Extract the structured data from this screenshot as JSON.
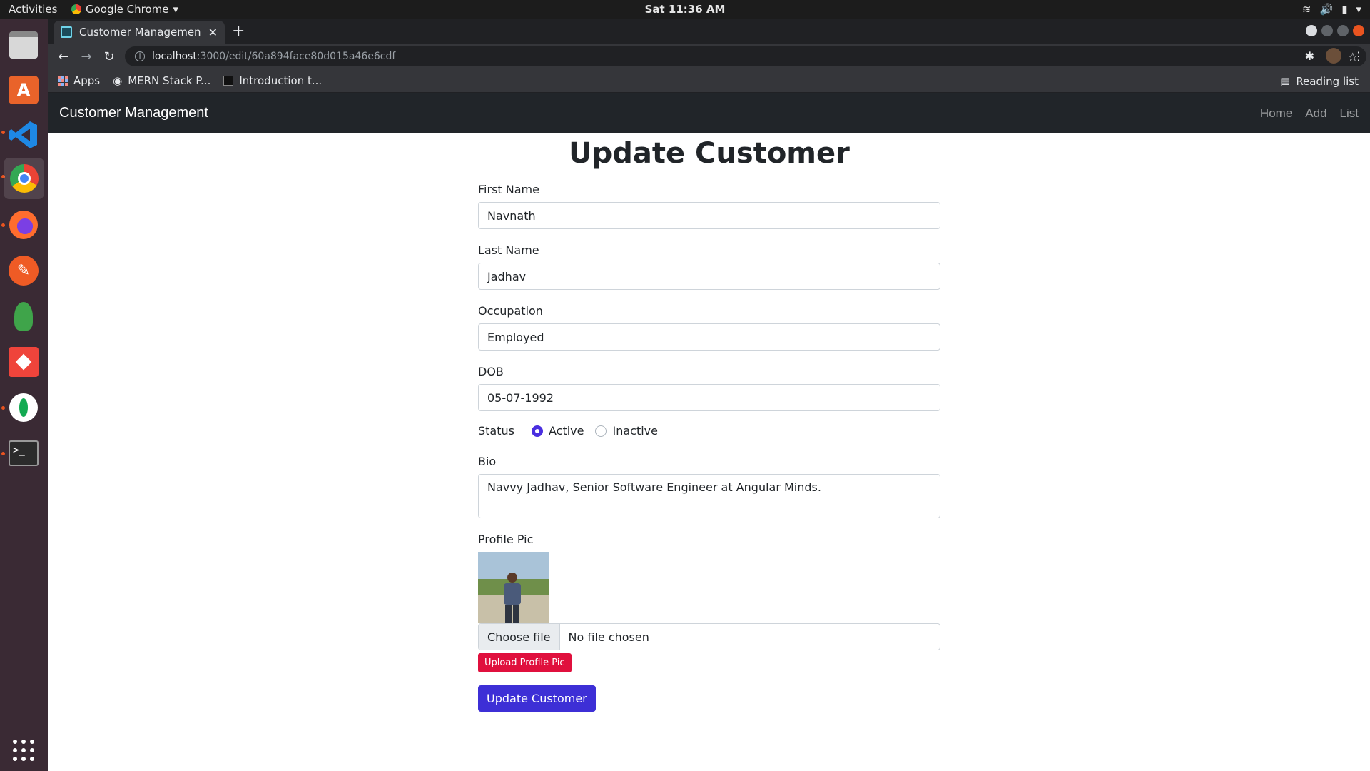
{
  "os": {
    "activities": "Activities",
    "app_menu": "Google Chrome",
    "clock": "Sat 11:36 AM"
  },
  "browser": {
    "tab_title": "Customer Management",
    "url_host": "localhost",
    "url_path": ":3000/edit/60a894face80d015a46e6cdf",
    "bookmarks": [
      "Apps",
      "MERN Stack P...",
      "Introduction t..."
    ],
    "reading_list": "Reading list"
  },
  "navbar": {
    "brand": "Customer Management",
    "links": [
      "Home",
      "Add",
      "List"
    ]
  },
  "form": {
    "title": "Update Customer",
    "first_name_label": "First Name",
    "first_name_value": "Navnath",
    "last_name_label": "Last Name",
    "last_name_value": "Jadhav",
    "occupation_label": "Occupation",
    "occupation_value": "Employed",
    "dob_label": "DOB",
    "dob_value": "05-07-1992",
    "status_label": "Status",
    "status_options": [
      "Active",
      "Inactive"
    ],
    "status_selected": "Active",
    "bio_label": "Bio",
    "bio_value": "Navvy Jadhav, Senior Software Engineer at Angular Minds.",
    "profile_pic_label": "Profile Pic",
    "choose_file": "Choose file",
    "no_file": "No file chosen",
    "upload_button": "Upload Profile Pic",
    "submit_button": "Update Customer"
  },
  "colors": {
    "navbar_bg": "#212529",
    "upload_btn": "#e0103d",
    "submit_btn": "#3d2fd6",
    "radio_active": "#4a2fe0"
  }
}
